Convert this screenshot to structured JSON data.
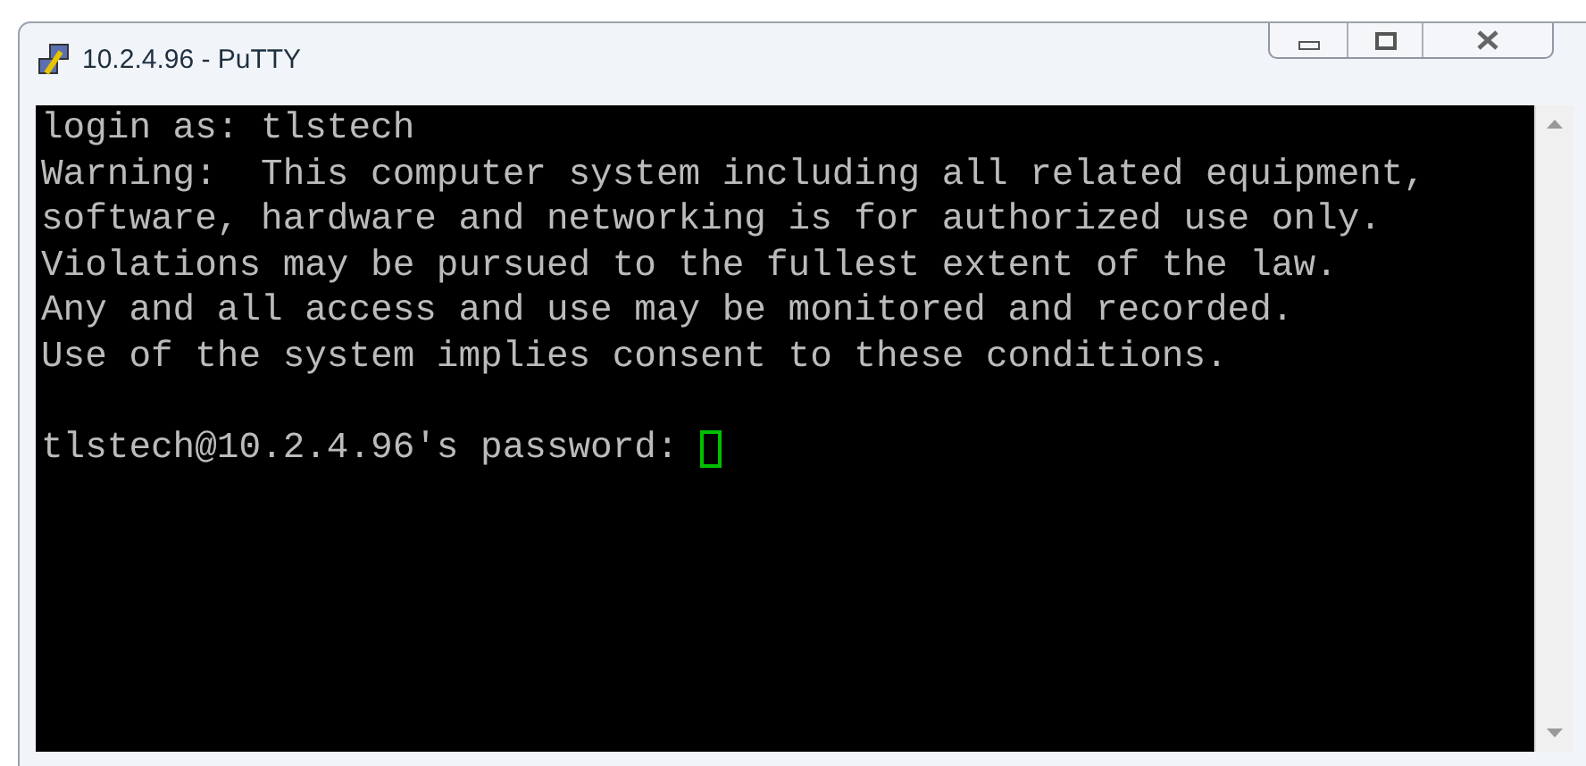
{
  "window": {
    "title": "10.2.4.96 - PuTTY"
  },
  "terminal": {
    "lines": [
      "login as: tlstech",
      "Warning:  This computer system including all related equipment,",
      "software, hardware and networking is for authorized use only.",
      "Violations may be pursued to the fullest extent of the law.",
      "Any and all access and use may be monitored and recorded.",
      "Use of the system implies consent to these conditions."
    ],
    "prompt": "tlstech@10.2.4.96's password:"
  }
}
